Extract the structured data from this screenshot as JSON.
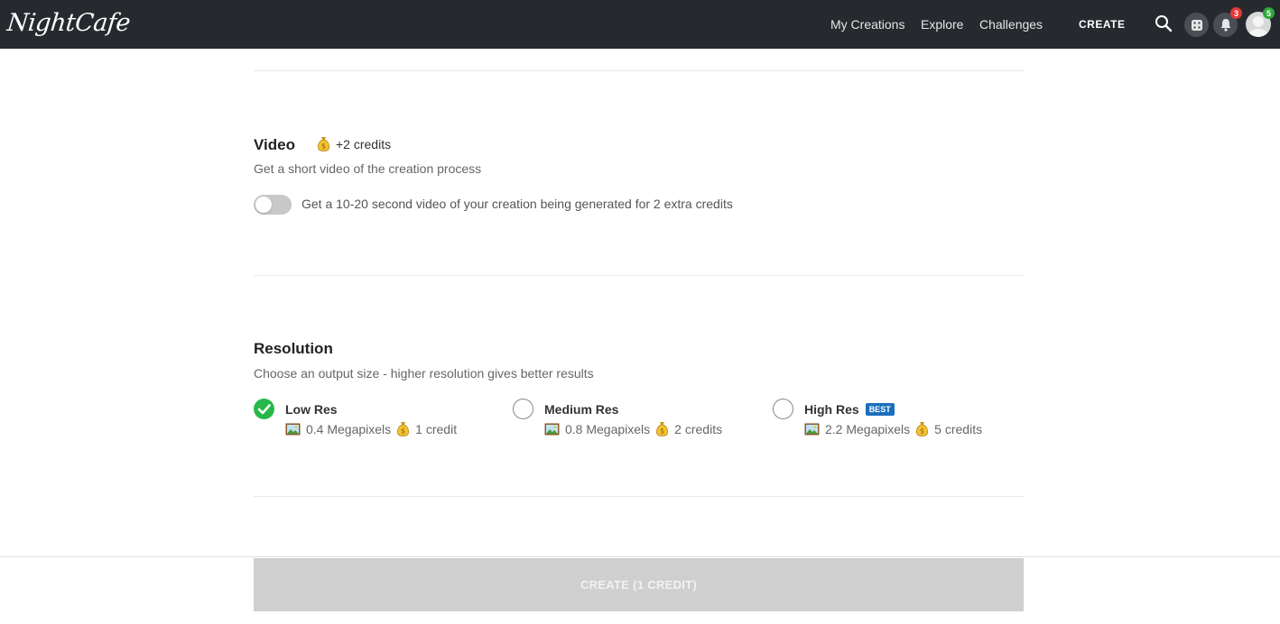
{
  "header": {
    "logo_text": "NightCafe",
    "nav": {
      "my_creations": "My Creations",
      "explore": "Explore",
      "challenges": "Challenges",
      "create": "CREATE"
    },
    "notifications_count": "3",
    "profile_badge_count": "5",
    "colors": {
      "background": "#262a2e",
      "notification_badge": "#e53935",
      "profile_badge": "#2eaa3c"
    }
  },
  "video": {
    "title": "Video",
    "credit_tag": "+2 credits",
    "description": "Get a short video of the creation process",
    "toggle_label": "Get a 10-20 second video of your creation being generated for 2 extra credits",
    "toggle_on": false
  },
  "resolution": {
    "title": "Resolution",
    "description": "Choose an output size - higher resolution gives better results",
    "options": [
      {
        "name": "Low Res",
        "megapixels": "0.4 Megapixels",
        "credits": "1 credit",
        "selected": true,
        "badge": ""
      },
      {
        "name": "Medium Res",
        "megapixels": "0.8 Megapixels",
        "credits": "2 credits",
        "selected": false,
        "badge": ""
      },
      {
        "name": "High Res",
        "megapixels": "2.2 Megapixels",
        "credits": "5 credits",
        "selected": false,
        "badge": "BEST"
      }
    ],
    "colors": {
      "selected": "#28b84a",
      "best_badge": "#1c6fbd"
    }
  },
  "footer": {
    "create_button_label": "CREATE (1 CREDIT)"
  }
}
